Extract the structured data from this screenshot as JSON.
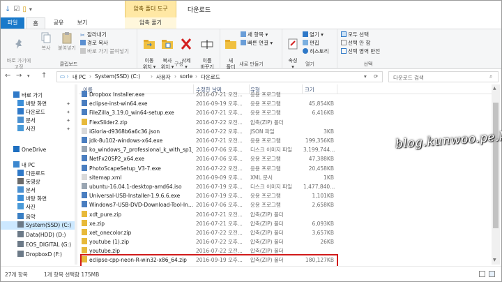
{
  "titlebar": {
    "context_tab": "압축 폴더 도구",
    "title": "다운로드",
    "quick_access": [
      "↓",
      "☑",
      "▯",
      "▾"
    ]
  },
  "tabs": {
    "file": "파일",
    "home": "홈",
    "share": "공유",
    "view": "보기",
    "extract": "압축 풀기"
  },
  "ribbon": {
    "clipboard": {
      "label": "클립보드",
      "pin": "바로 가기에\n고정",
      "copy": "복사",
      "paste": "붙여넣기",
      "cut": "잘라내기",
      "copy_path": "경로 복사",
      "paste_shortcut": "바로 가기 붙여넣기"
    },
    "organize": {
      "label": "구성",
      "move": "이동\n위치 ▾",
      "copy_to": "복사\n위치 ▾",
      "delete": "삭제\n▾",
      "rename": "이름\n바꾸기"
    },
    "new": {
      "label": "새로 만들기",
      "new_item": "새 항목 ▾",
      "easy_access": "빠른 연결 ▾",
      "new_folder": "새\n폴더"
    },
    "open": {
      "label": "열기",
      "properties": "속성\n▾",
      "open": "열기 ▾",
      "edit": "편집",
      "history": "히스토리"
    },
    "select": {
      "label": "선택",
      "select_all": "모두 선택",
      "select_none": "선택 안 함",
      "invert": "선택 영역 반전"
    }
  },
  "address": {
    "crumbs": [
      "내 PC",
      "System(SSD) (C:)",
      "사용자",
      "sorle",
      "다운로드"
    ],
    "search_placeholder": "다운로드 검색"
  },
  "nav": {
    "items": [
      {
        "label": "바로 가기",
        "icon": "star-icon",
        "color": "#2f79c8",
        "pinned": false
      },
      {
        "label": "바탕 화면",
        "icon": "desktop-icon",
        "color": "#3d8fd8",
        "pinned": true
      },
      {
        "label": "다운로드",
        "icon": "download-icon",
        "color": "#2f79c8",
        "pinned": true
      },
      {
        "label": "문서",
        "icon": "document-icon",
        "color": "#4a90d0",
        "pinned": true
      },
      {
        "label": "사진",
        "icon": "picture-icon",
        "color": "#4a9ad8",
        "pinned": true
      },
      {
        "label": "OneDrive",
        "icon": "cloud-icon",
        "color": "#1e6fc0",
        "pinned": false
      },
      {
        "label": "내 PC",
        "icon": "computer-icon",
        "color": "#3b87cf",
        "pinned": false
      },
      {
        "label": "다운로드",
        "icon": "download-icon",
        "color": "#2f79c8",
        "pinned": false
      },
      {
        "label": "동영상",
        "icon": "video-icon",
        "color": "#6b6b6b",
        "pinned": false
      },
      {
        "label": "문서",
        "icon": "document-icon",
        "color": "#4a90d0",
        "pinned": false
      },
      {
        "label": "바탕 화면",
        "icon": "desktop-icon",
        "color": "#3d8fd8",
        "pinned": false
      },
      {
        "label": "사진",
        "icon": "picture-icon",
        "color": "#4a9ad8",
        "pinned": false
      },
      {
        "label": "음악",
        "icon": "music-icon",
        "color": "#3a7fc4",
        "pinned": false
      },
      {
        "label": "System(SSD) (C:)",
        "icon": "drive-icon",
        "color": "#6c7a88",
        "pinned": false
      },
      {
        "label": "Data(HDD) (D:)",
        "icon": "drive-icon",
        "color": "#6c7a88",
        "pinned": false
      },
      {
        "label": "EOS_DIGITAL (G:)",
        "icon": "drive-icon",
        "color": "#6c7a88",
        "pinned": false
      },
      {
        "label": "DropboxD (F:)",
        "icon": "drive-icon",
        "color": "#6c7a88",
        "pinned": false
      }
    ]
  },
  "columns": {
    "name": "이름",
    "date": "수정한 날짜",
    "type": "유형",
    "size": "크기"
  },
  "files": [
    {
      "name": "Dropbox Installer.exe",
      "date": "2016-07-21 오전...",
      "type": "응용 프로그램",
      "size": "",
      "icon": "exe-icon"
    },
    {
      "name": "eclipse-inst-win64.exe",
      "date": "2016-09-19 오후...",
      "type": "응용 프로그램",
      "size": "45,854KB",
      "icon": "exe-icon"
    },
    {
      "name": "FileZilla_3.19.0_win64-setup.exe",
      "date": "2016-07-21 오후...",
      "type": "응용 프로그램",
      "size": "6,416KB",
      "icon": "exe-icon"
    },
    {
      "name": "FlexSlider2.zip",
      "date": "2016-07-22 오전...",
      "type": "압축(ZIP) 폴더",
      "size": "",
      "icon": "zip-icon"
    },
    {
      "name": "iGloria-d9368b6a6c36.json",
      "date": "2016-07-22 오후...",
      "type": "JSON 파일",
      "size": "3KB",
      "icon": "file-icon"
    },
    {
      "name": "jdk-8u102-windows-x64.exe",
      "date": "2016-07-21 오전...",
      "type": "응용 프로그램",
      "size": "199,356KB",
      "icon": "exe-icon"
    },
    {
      "name": "ko_windows_7_professional_k_with_sp1_...",
      "date": "2016-07-06 오후...",
      "type": "디스크 이미지 파일",
      "size": "3,199,744...",
      "icon": "disc-icon"
    },
    {
      "name": "NetFx20SP2_x64.exe",
      "date": "2016-07-06 오후...",
      "type": "응용 프로그램",
      "size": "47,388KB",
      "icon": "exe-icon"
    },
    {
      "name": "PhotoScapeSetup_V3-7.exe",
      "date": "2016-07-22 오전...",
      "type": "응용 프로그램",
      "size": "20,458KB",
      "icon": "exe-icon"
    },
    {
      "name": "sitemap.xml",
      "date": "2016-09-09 오후...",
      "type": "XML 문서",
      "size": "1KB",
      "icon": "file-icon"
    },
    {
      "name": "ubuntu-16.04.1-desktop-amd64.iso",
      "date": "2016-07-19 오후...",
      "type": "디스크 이미지 파일",
      "size": "1,477,840...",
      "icon": "disc-icon"
    },
    {
      "name": "Universal-USB-Installer-1.9.6.6.exe",
      "date": "2016-07-19 오후...",
      "type": "응용 프로그램",
      "size": "1,101KB",
      "icon": "exe-icon"
    },
    {
      "name": "Windows7-USB-DVD-Download-Tool-In...",
      "date": "2016-07-06 오후...",
      "type": "응용 프로그램",
      "size": "2,658KB",
      "icon": "exe-icon"
    },
    {
      "name": "xdt_pure.zip",
      "date": "2016-07-21 오전...",
      "type": "압축(ZIP) 폴더",
      "size": "",
      "icon": "zip-icon"
    },
    {
      "name": "xe.zip",
      "date": "2016-07-21 오후...",
      "type": "압축(ZIP) 폴더",
      "size": "6,093KB",
      "icon": "zip-icon"
    },
    {
      "name": "xet_onecolor.zip",
      "date": "2016-07-22 오전...",
      "type": "압축(ZIP) 폴더",
      "size": "3,657KB",
      "icon": "zip-icon"
    },
    {
      "name": "youtube (1).zip",
      "date": "2016-07-22 오후...",
      "type": "압축(ZIP) 폴더",
      "size": "26KB",
      "icon": "zip-icon"
    },
    {
      "name": "youtube.zip",
      "date": "2016-07-22 오전...",
      "type": "압축(ZIP) 폴더",
      "size": "",
      "icon": "zip-icon"
    },
    {
      "name": "eclipse-cpp-neon-R-win32-x86_64.zip",
      "date": "2016-09-19 오후...",
      "type": "압축(ZIP) 폴더",
      "size": "180,127KB",
      "icon": "zip-icon"
    }
  ],
  "watermark": "blog.kunwoo.pe.kr",
  "status": {
    "count": "27개 항목",
    "selection": "1개 항목 선택함 175MB"
  },
  "colors": {
    "file_tab": "#1979ca",
    "context_tab": "#ffe8a4",
    "selection": "#cce8ff",
    "highlight": "#d11a1a"
  }
}
